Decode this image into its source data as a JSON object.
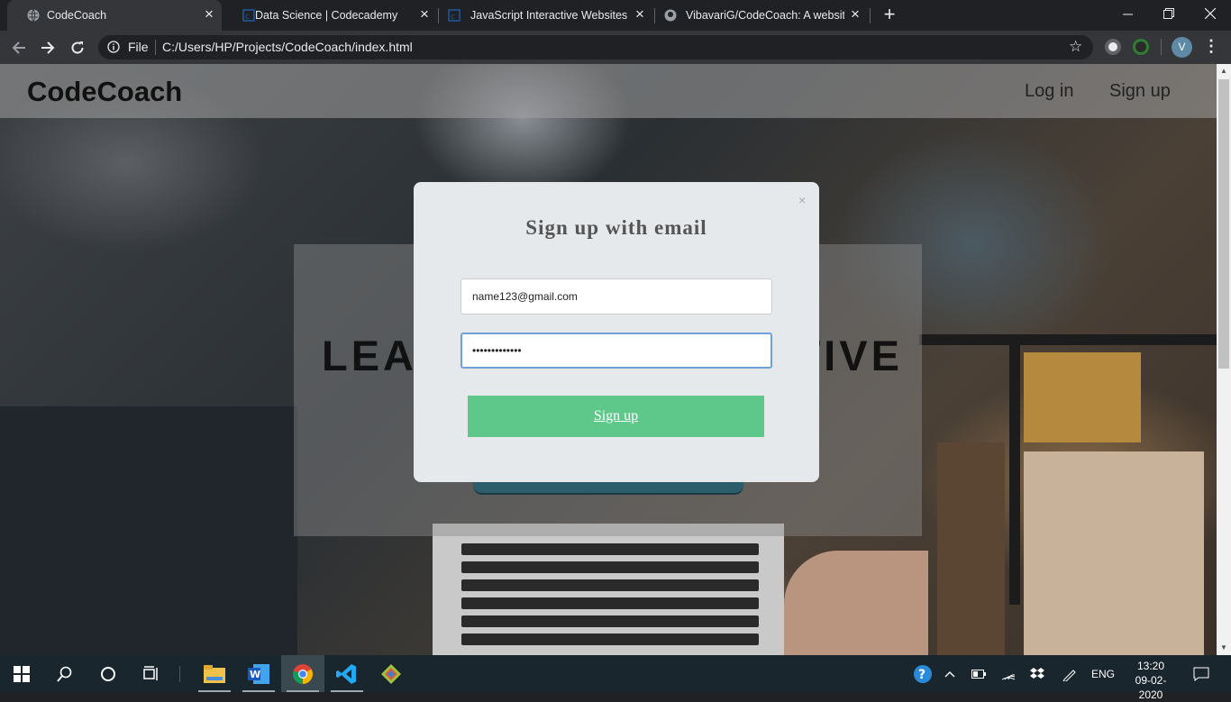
{
  "browser": {
    "tabs": [
      {
        "label": "CodeCoach",
        "active": true,
        "icon": "globe-icon"
      },
      {
        "label": "Data Science | Codecademy",
        "active": false,
        "icon": "codecademy-icon"
      },
      {
        "label": "JavaScript Interactive Websites | C",
        "active": false,
        "icon": "codecademy-icon"
      },
      {
        "label": "VibavariG/CodeCoach: A website",
        "active": false,
        "icon": "github-icon"
      }
    ],
    "omnibox": {
      "scheme_label": "File",
      "url": "C:/Users/HP/Projects/CodeCoach/index.html"
    },
    "profile_initial": "V"
  },
  "page": {
    "brand": "CodeCoach",
    "nav": {
      "login": "Log in",
      "signup": "Sign up"
    },
    "hero_title": "LEARN TO BE CREATIVE"
  },
  "modal": {
    "close": "×",
    "title": "Sign up with email",
    "email_value": "name123@gmail.com",
    "password_value": "•••••••••••••",
    "submit_label": "Sign up"
  },
  "taskbar": {
    "language": "ENG",
    "time": "13:20",
    "date": "09-02-2020"
  },
  "colors": {
    "signup_button": "#5ec78a",
    "modal_bg": "#e6e9ec",
    "taskbar_bg": "#19262e",
    "chrome_dark": "#202124"
  }
}
